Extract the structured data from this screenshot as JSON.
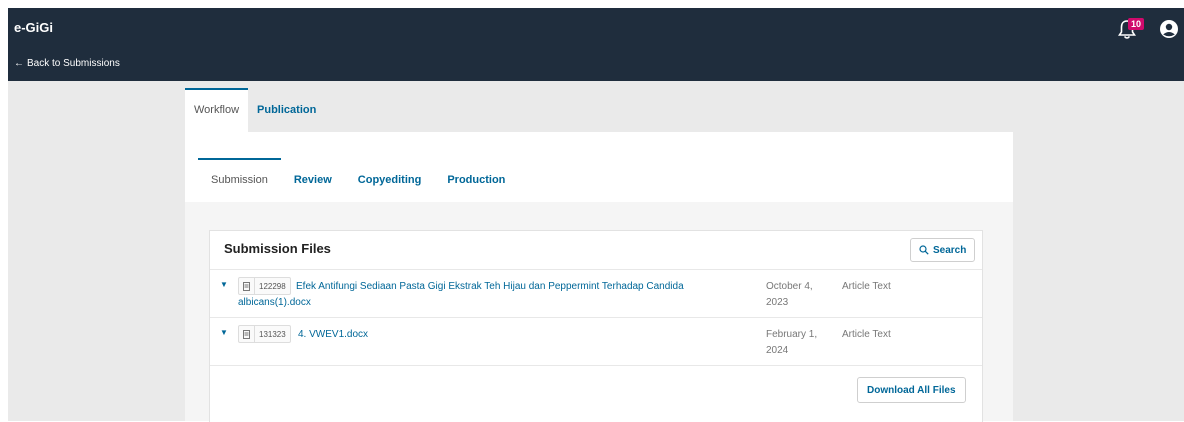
{
  "header": {
    "app_name": "e-GiGi",
    "back_link": "Back to Submissions",
    "back_arrow": "←",
    "notifications_count": "10",
    "icons": {
      "notifications": "bell-icon",
      "user": "user-circle-icon"
    },
    "colors": {
      "topbar": "#1f2d3d",
      "badge": "#d00a6c",
      "accent": "#006798"
    }
  },
  "outer_tabs": [
    {
      "label": "Workflow",
      "active": true
    },
    {
      "label": "Publication",
      "active": false
    }
  ],
  "stage_tabs": [
    {
      "label": "Submission",
      "active": true
    },
    {
      "label": "Review",
      "active": false
    },
    {
      "label": "Copyediting",
      "active": false
    },
    {
      "label": "Production",
      "active": false
    }
  ],
  "files_panel": {
    "title": "Submission Files",
    "search_label": "Search",
    "download_all_label": "Download All Files",
    "files": [
      {
        "id": "122298",
        "name": "Efek Antifungi Sediaan Pasta Gigi Ekstrak Teh Hijau dan Peppermint Terhadap Candida albicans(1).docx",
        "date": "October 4, 2023",
        "type": "Article Text"
      },
      {
        "id": "131323",
        "name": "4. VWEV1.docx",
        "date": "February 1, 2024",
        "type": "Article Text"
      }
    ]
  }
}
